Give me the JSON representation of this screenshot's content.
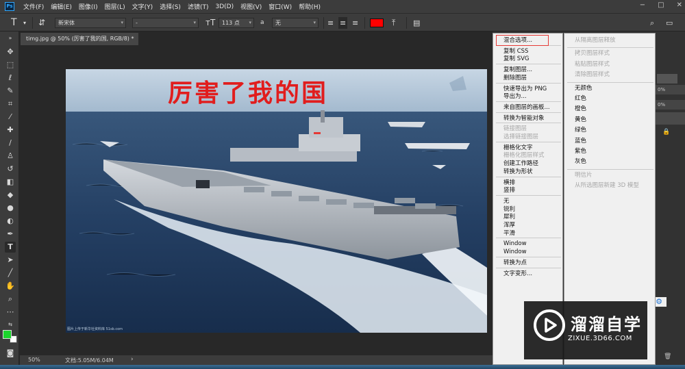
{
  "menubar": {
    "logo": "Ps",
    "items": [
      "文件(F)",
      "编辑(E)",
      "图像(I)",
      "图层(L)",
      "文字(Y)",
      "选择(S)",
      "滤镜(T)",
      "3D(D)",
      "视图(V)",
      "窗口(W)",
      "帮助(H)"
    ]
  },
  "options": {
    "font_family": "新宋体",
    "font_style": "-",
    "font_size": "113 点",
    "aa_label": "a",
    "antialias": "无",
    "text_color": "#ff0000"
  },
  "document": {
    "tab_title": "timg.jpg @ 50% (厉害了我的国, RGB/8) *",
    "text_layer": "厉害了我的国",
    "caption": "图片上传于新华社资料库 51sb.com"
  },
  "status": {
    "zoom": "50%",
    "doc_info": "文档:5.05M/6.04M"
  },
  "context_menu_1": [
    {
      "label": "混合选项...",
      "enabled": true,
      "highlighted": true
    },
    {
      "sep": true
    },
    {
      "label": "复制 CSS",
      "enabled": true
    },
    {
      "label": "复制 SVG",
      "enabled": true
    },
    {
      "sep": true
    },
    {
      "label": "复制图层...",
      "enabled": true
    },
    {
      "label": "删除图层",
      "enabled": true
    },
    {
      "sep": true
    },
    {
      "label": "快速导出为 PNG",
      "enabled": true
    },
    {
      "label": "导出为...",
      "enabled": true
    },
    {
      "sep": true
    },
    {
      "label": "来自图层的画板...",
      "enabled": true
    },
    {
      "sep": true
    },
    {
      "label": "转换为智能对象",
      "enabled": true
    },
    {
      "sep": true
    },
    {
      "label": "链接图层",
      "enabled": false
    },
    {
      "label": "选择链接图层",
      "enabled": false
    },
    {
      "sep": true
    },
    {
      "label": "栅格化文字",
      "enabled": true
    },
    {
      "label": "栅格化图层样式",
      "enabled": false
    },
    {
      "label": "创建工作路径",
      "enabled": true
    },
    {
      "label": "转换为形状",
      "enabled": true
    },
    {
      "sep": true
    },
    {
      "label": "横排",
      "enabled": true
    },
    {
      "label": "竖排",
      "enabled": true
    },
    {
      "sep": true
    },
    {
      "label": "无",
      "enabled": true
    },
    {
      "label": "锐利",
      "enabled": true
    },
    {
      "label": "犀利",
      "enabled": true
    },
    {
      "label": "浑厚",
      "enabled": true
    },
    {
      "label": "平滑",
      "enabled": true
    },
    {
      "sep": true
    },
    {
      "label": "Window",
      "enabled": true
    },
    {
      "label": "Window",
      "enabled": true
    },
    {
      "sep": true
    },
    {
      "label": "转换为点",
      "enabled": true
    },
    {
      "sep": true
    },
    {
      "label": "文字变形...",
      "enabled": true
    }
  ],
  "context_menu_2": [
    {
      "label": "从隔离图层释放",
      "enabled": false
    },
    {
      "sep": true
    },
    {
      "label": "拷贝图层样式",
      "enabled": false
    },
    {
      "label": "粘贴图层样式",
      "enabled": false
    },
    {
      "label": "清除图层样式",
      "enabled": false
    },
    {
      "sep": true
    },
    {
      "label": "无颜色",
      "enabled": true
    },
    {
      "label": "红色",
      "enabled": true
    },
    {
      "label": "橙色",
      "enabled": true
    },
    {
      "label": "黄色",
      "enabled": true
    },
    {
      "label": "绿色",
      "enabled": true
    },
    {
      "label": "蓝色",
      "enabled": true
    },
    {
      "label": "紫色",
      "enabled": true
    },
    {
      "label": "灰色",
      "enabled": true
    },
    {
      "sep": true
    },
    {
      "label": "明信片",
      "enabled": false
    },
    {
      "label": "从所选图层新建 3D 模型",
      "enabled": false
    }
  ],
  "right_panel": {
    "pct1": "0%",
    "pct2": "0%"
  },
  "watermark": {
    "title": "溜溜自学",
    "url": "ZIXUE.3D66.COM"
  }
}
